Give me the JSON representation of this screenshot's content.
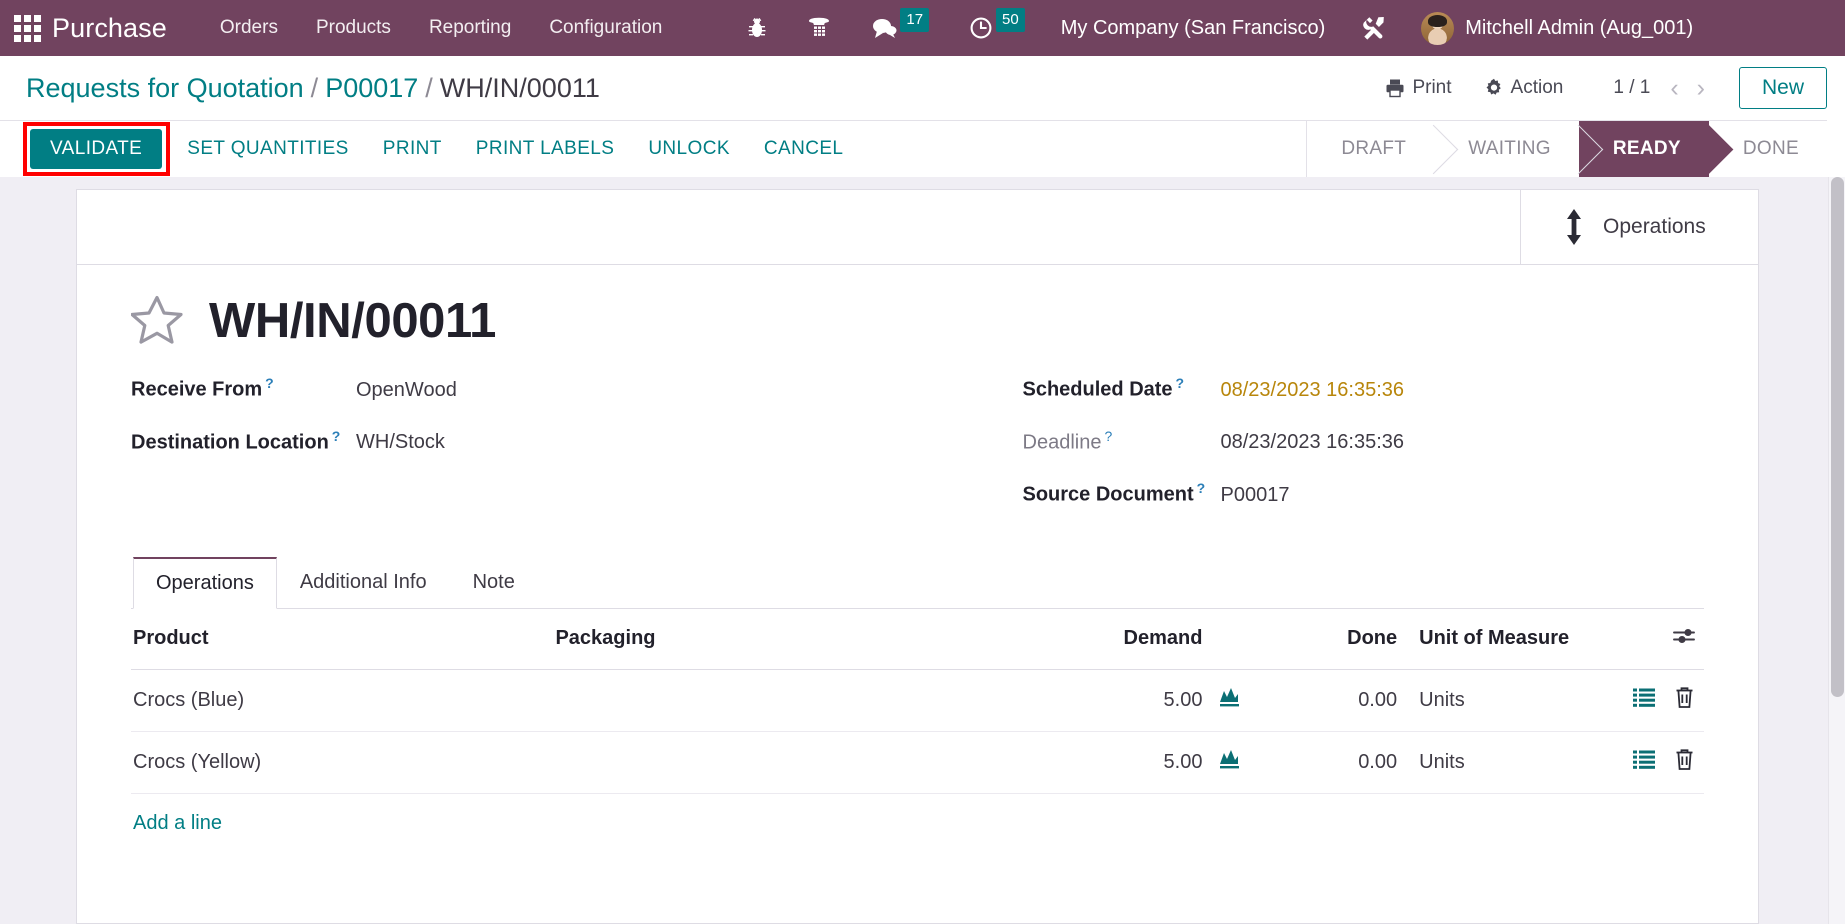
{
  "navbar": {
    "apps_icon": "apps-grid-icon",
    "brand": "Purchase",
    "menu": [
      {
        "label": "Orders"
      },
      {
        "label": "Products"
      },
      {
        "label": "Reporting"
      },
      {
        "label": "Configuration"
      }
    ],
    "icons": [
      {
        "name": "bug-icon"
      },
      {
        "name": "dialpad-icon"
      }
    ],
    "messages": {
      "icon": "chat-bubble-icon",
      "count": "17"
    },
    "activities": {
      "icon": "clock-icon",
      "count": "50"
    },
    "company": "My Company (San Francisco)",
    "settings_icon": "tools-icon",
    "user": "Mitchell Admin (Aug_001)",
    "accent_color": "#71435f",
    "badge_color": "#017e84"
  },
  "control_panel": {
    "breadcrumb": {
      "root": "Requests for Quotation",
      "parent": "P00017",
      "current": "WH/IN/00011",
      "separator": "/"
    },
    "print_label": "Print",
    "print_icon": "printer-icon",
    "action_label": "Action",
    "action_icon": "gear-icon",
    "pager": "1 / 1",
    "prev_icon": "chevron-left-icon",
    "next_icon": "chevron-right-icon",
    "new_label": "New"
  },
  "buttons": [
    {
      "label": "VALIDATE",
      "style": "primary",
      "highlighted": true
    },
    {
      "label": "SET QUANTITIES",
      "style": "text"
    },
    {
      "label": "PRINT",
      "style": "text"
    },
    {
      "label": "PRINT LABELS",
      "style": "text"
    },
    {
      "label": "UNLOCK",
      "style": "text"
    },
    {
      "label": "CANCEL",
      "style": "text"
    }
  ],
  "statusbar": {
    "stages": [
      {
        "label": "DRAFT",
        "active": false
      },
      {
        "label": "WAITING",
        "active": false
      },
      {
        "label": "READY",
        "active": true
      },
      {
        "label": "DONE",
        "active": false
      }
    ],
    "active_color": "#71435f"
  },
  "smart_buttons": [
    {
      "label": "Operations",
      "icon": "arrows-vertical-icon"
    }
  ],
  "record": {
    "star_icon": "star-icon",
    "title": "WH/IN/00011",
    "left_fields": [
      {
        "label": "Receive From",
        "value": "OpenWood",
        "help": "?",
        "muted": false,
        "warn": false
      },
      {
        "label": "Destination Location",
        "value": "WH/Stock",
        "help": "?",
        "muted": false,
        "warn": false
      }
    ],
    "right_fields": [
      {
        "label": "Scheduled Date",
        "value": "08/23/2023 16:35:36",
        "help": "?",
        "muted": false,
        "warn": true
      },
      {
        "label": "Deadline",
        "value": "08/23/2023 16:35:36",
        "help": "?",
        "muted": true,
        "warn": false
      },
      {
        "label": "Source Document",
        "value": "P00017",
        "help": "?",
        "muted": false,
        "warn": false
      }
    ]
  },
  "tabs": [
    {
      "label": "Operations",
      "active": true
    },
    {
      "label": "Additional Info",
      "active": false
    },
    {
      "label": "Note",
      "active": false
    }
  ],
  "table": {
    "columns": [
      "Product",
      "Packaging",
      "Demand",
      "Done",
      "Unit of Measure"
    ],
    "optional_columns_icon": "sliders-icon",
    "rows": [
      {
        "product": "Crocs (Blue)",
        "packaging": "",
        "demand": "5.00",
        "forecast_icon": "forecast-chart-icon",
        "done": "0.00",
        "uom": "Units",
        "detail_icon": "list-icon",
        "delete_icon": "trash-icon"
      },
      {
        "product": "Crocs (Yellow)",
        "packaging": "",
        "demand": "5.00",
        "forecast_icon": "forecast-chart-icon",
        "done": "0.00",
        "uom": "Units",
        "detail_icon": "list-icon",
        "delete_icon": "trash-icon"
      }
    ],
    "add_line_label": "Add a line"
  }
}
